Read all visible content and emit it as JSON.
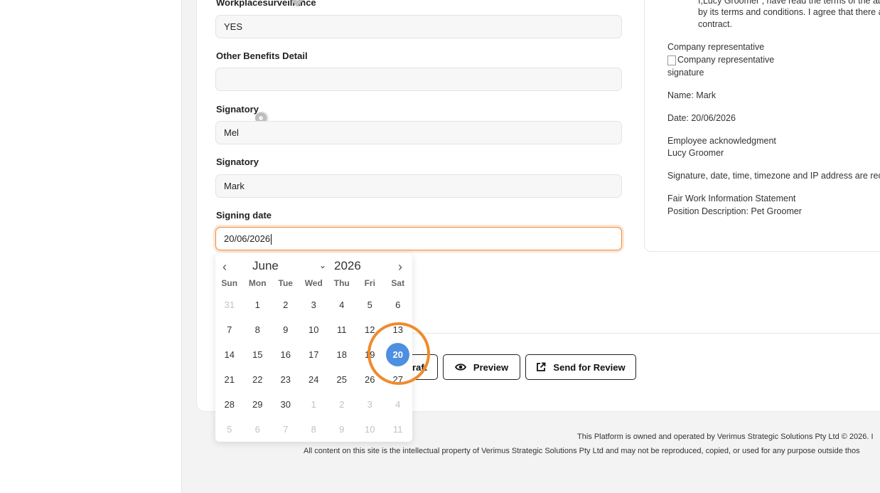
{
  "fields": [
    {
      "label": "Workplacesurveillance",
      "value": "YES"
    },
    {
      "label": "Other Benefits Detail",
      "value": ""
    },
    {
      "label": "Signatory",
      "value": "Mel"
    },
    {
      "label": "Signatory",
      "value": "Mark"
    },
    {
      "label": "Signing date",
      "value": "20/06/2026"
    }
  ],
  "side": {
    "terms_line1": "I,Lucy Groomer , have read the terms of the abo",
    "terms_line2": "by its terms and conditions. I agree that there a",
    "terms_line3": "contract.",
    "rep_label": "Company representative",
    "rep_img_alt1": "Company representative",
    "rep_img_alt2": "signature",
    "name": "Name: Mark",
    "date": "Date: 20/06/2026",
    "ack_label": "Employee acknowledgment",
    "ack_name": "Lucy Groomer",
    "signature_note": "Signature, date, time, timezone and IP address are reco",
    "doc1": "Fair Work Information Statement",
    "doc2": "Position Description: Pet Groomer"
  },
  "buttons": {
    "draft": "raft",
    "preview": "Preview",
    "send": "Send for Review"
  },
  "calendar": {
    "month": "June",
    "year": "2026",
    "prev_glyph": "‹",
    "next_glyph": "›",
    "chevron_glyph": "⌄",
    "weekdays": [
      "Sun",
      "Mon",
      "Tue",
      "Wed",
      "Thu",
      "Fri",
      "Sat"
    ],
    "weeks": [
      [
        "31",
        "1",
        "2",
        "3",
        "4",
        "5",
        "6"
      ],
      [
        "7",
        "8",
        "9",
        "10",
        "11",
        "12",
        "13"
      ],
      [
        "14",
        "15",
        "16",
        "17",
        "18",
        "19",
        "20"
      ],
      [
        "21",
        "22",
        "23",
        "24",
        "25",
        "26",
        "27"
      ],
      [
        "28",
        "29",
        "30",
        "1",
        "2",
        "3",
        "4"
      ],
      [
        "5",
        "6",
        "7",
        "8",
        "9",
        "10",
        "11"
      ]
    ],
    "selected": "20"
  },
  "footer": {
    "line1": "This Platform is owned and operated by Verimus Strategic Solutions Pty Ltd © 2026. I",
    "line2": "All content on this site is the intellectual property of Verimus Strategic Solutions Pty Ltd and may not be reproduced, copied, or used for any purpose outside thos"
  },
  "colors": {
    "accent": "#f28b3a",
    "selected_day": "#4d8fe0",
    "highlight_ring": "#f08a2c"
  },
  "icons": {
    "preview": "eye-icon",
    "send": "external-link-icon",
    "pin": "location-pin-icon"
  }
}
